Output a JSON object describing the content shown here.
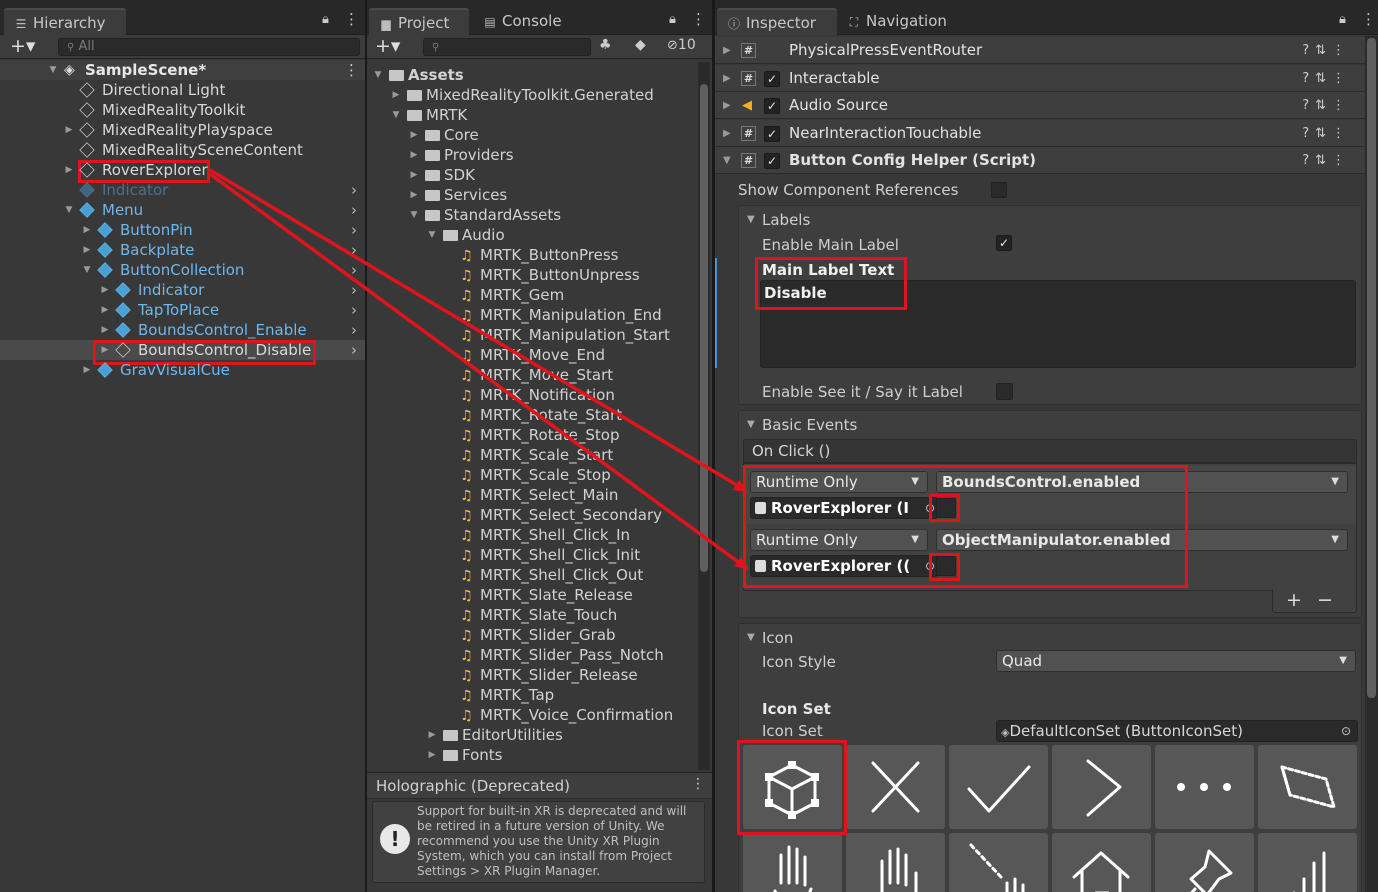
{
  "hierarchy": {
    "tab_label": "Hierarchy",
    "search_placeholder": "All",
    "scene": "SampleScene*",
    "items": [
      {
        "label": "Directional Light",
        "style": "normal"
      },
      {
        "label": "MixedRealityToolkit",
        "style": "normal"
      },
      {
        "label": "MixedRealityPlayspace",
        "style": "normal"
      },
      {
        "label": "MixedRealitySceneContent",
        "style": "normal"
      },
      {
        "label": "RoverExplorer",
        "style": "normal"
      },
      {
        "label": "Indicator",
        "style": "disabled"
      },
      {
        "label": "Menu",
        "style": "prefab"
      },
      {
        "label": "ButtonPin",
        "style": "prefab"
      },
      {
        "label": "Backplate",
        "style": "prefab"
      },
      {
        "label": "ButtonCollection",
        "style": "prefab"
      },
      {
        "label": "Indicator",
        "style": "prefab"
      },
      {
        "label": "TapToPlace",
        "style": "prefab"
      },
      {
        "label": "BoundsControl_Enable",
        "style": "prefab"
      },
      {
        "label": "BoundsControl_Disable",
        "style": "normal"
      },
      {
        "label": "GravVisualCue",
        "style": "prefab"
      }
    ]
  },
  "project": {
    "tab_project": "Project",
    "tab_console": "Console",
    "hidden_count": "10",
    "root": "Assets",
    "folders": [
      "MixedRealityToolkit.Generated",
      "MRTK",
      "Core",
      "Providers",
      "SDK",
      "Services",
      "StandardAssets",
      "Audio"
    ],
    "audio_files": [
      "MRTK_ButtonPress",
      "MRTK_ButtonUnpress",
      "MRTK_Gem",
      "MRTK_Manipulation_End",
      "MRTK_Manipulation_Start",
      "MRTK_Move_End",
      "MRTK_Move_Start",
      "MRTK_Notification",
      "MRTK_Rotate_Start",
      "MRTK_Rotate_Stop",
      "MRTK_Scale_Start",
      "MRTK_Scale_Stop",
      "MRTK_Select_Main",
      "MRTK_Select_Secondary",
      "MRTK_Shell_Click_In",
      "MRTK_Shell_Click_Init",
      "MRTK_Shell_Click_Out",
      "MRTK_Slate_Release",
      "MRTK_Slate_Touch",
      "MRTK_Slider_Grab",
      "MRTK_Slider_Pass_Notch",
      "MRTK_Slider_Release",
      "MRTK_Tap",
      "MRTK_Voice_Confirmation"
    ],
    "more_folders": [
      "EditorUtilities",
      "Fonts"
    ],
    "holo_title": "Holographic (Deprecated)",
    "holo_message": "Support for built-in XR is deprecated and will be retired in a future version of Unity. We recommend you use the Unity XR Plugin System, which you can install from Project Settings > XR Plugin Manager."
  },
  "inspector": {
    "tab_inspector": "Inspector",
    "tab_navigation": "Navigation",
    "components": [
      {
        "name": "PhysicalPressEventRouter",
        "checkbox": false,
        "icon": "script-icon"
      },
      {
        "name": "Interactable",
        "checkbox": true,
        "icon": "script-icon"
      },
      {
        "name": "Audio Source",
        "checkbox": true,
        "icon": "audio-source-icon"
      },
      {
        "name": "NearInteractionTouchable",
        "checkbox": true,
        "icon": "script-icon"
      },
      {
        "name": "Button Config Helper (Script)",
        "checkbox": true,
        "icon": "script-icon"
      }
    ],
    "show_refs": "Show Component References",
    "labels_section": "Labels",
    "enable_main_label": "Enable Main Label",
    "main_label_text": "Main Label Text",
    "main_label_value": "Disable",
    "enable_see_it": "Enable See it / Say it Label",
    "basic_events": "Basic Events",
    "on_click": "On Click ()",
    "events": [
      {
        "mode": "Runtime Only",
        "function": "BoundsControl.enabled",
        "object": "RoverExplorer (I"
      },
      {
        "mode": "Runtime Only",
        "function": "ObjectManipulator.enabled",
        "object": "RoverExplorer (("
      }
    ],
    "plus": "+",
    "minus": "−",
    "icon_section": "Icon",
    "icon_style_label": "Icon Style",
    "icon_style_value": "Quad",
    "icon_set_header": "Icon Set",
    "icon_set_label": "Icon Set",
    "icon_set_value": "DefaultIconSet (ButtonIconSet)",
    "icon_tiles": [
      "bounds-cube-icon",
      "close-x-icon",
      "checkmark-icon",
      "chevron-right-icon",
      "ellipsis-icon",
      "slate-icon",
      "hand-joints-icon",
      "hand-icon",
      "hand-ray-icon",
      "home-icon",
      "pin-icon",
      "bar-chart-icon"
    ]
  }
}
